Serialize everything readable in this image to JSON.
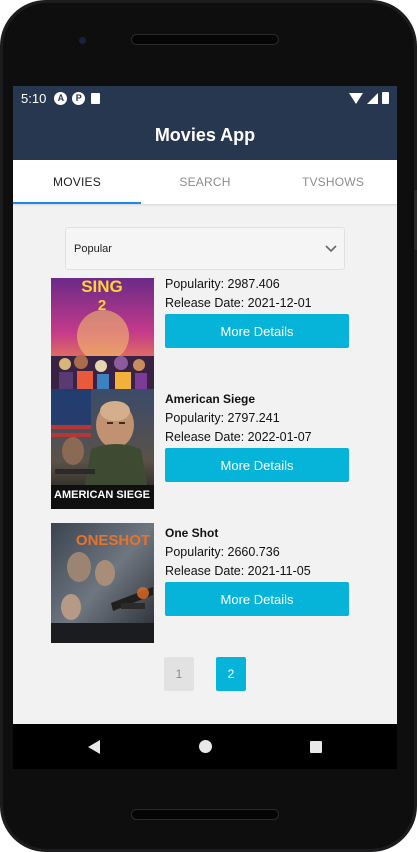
{
  "status_bar": {
    "time": "5:10",
    "icons": [
      "a-icon",
      "notification-icon",
      "sd-card-icon"
    ],
    "right_icons": [
      "wifi-icon",
      "signal-icon",
      "battery-icon"
    ]
  },
  "app": {
    "title": "Movies App"
  },
  "tabs": [
    {
      "label": "MOVIES",
      "active": true
    },
    {
      "label": "SEARCH",
      "active": false
    },
    {
      "label": "TVSHOWS",
      "active": false
    }
  ],
  "filter": {
    "selected": "Popular"
  },
  "movies": [
    {
      "title": "",
      "popularity": "Popularity: 2987.406",
      "release": "Release Date: 2021-12-01",
      "button": "More Details",
      "poster_text": "SING 2"
    },
    {
      "title": "American Siege",
      "popularity": "Popularity: 2797.241",
      "release": "Release Date: 2022-01-07",
      "button": "More Details",
      "poster_text": "AMERICAN SIEGE"
    },
    {
      "title": "One Shot",
      "popularity": "Popularity: 2660.736",
      "release": "Release Date: 2021-11-05",
      "button": "More Details",
      "poster_text": "ONESHOT"
    }
  ],
  "pagination": {
    "pages": [
      "1",
      "2"
    ],
    "current": "2"
  },
  "colors": {
    "app_bar": "#283750",
    "accent": "#05b4d8",
    "tab_indicator": "#1e88e5"
  }
}
